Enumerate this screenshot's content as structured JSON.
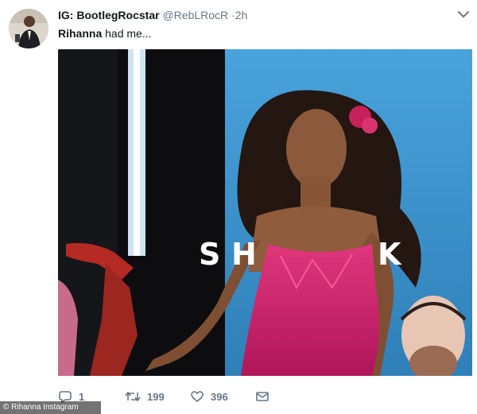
{
  "header": {
    "display_name": "IG: BootlegRocstar",
    "handle": "@RebLRocR",
    "separator": "·",
    "time": "2h"
  },
  "tweet": {
    "mention": "Rihanna",
    "text_rest": " had me..."
  },
  "media": {
    "overlay_text": [
      "S",
      "H",
      "K"
    ]
  },
  "actions": {
    "reply_count": "1",
    "retweet_count": "199",
    "like_count": "396"
  },
  "credit": "© Rihanna Instagram",
  "colors": {
    "secondary_text": "#657786",
    "stage_blue": "#3f95cf",
    "dress_pink": "#d0216b"
  }
}
